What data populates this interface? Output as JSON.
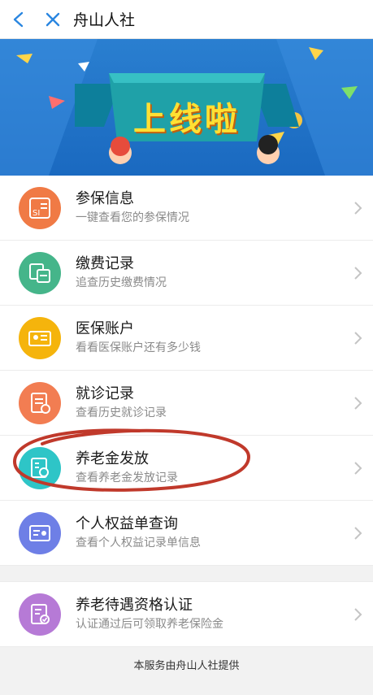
{
  "header": {
    "title": "舟山人社"
  },
  "banner": {
    "text": "上线啦"
  },
  "menu": [
    {
      "title": "参保信息",
      "subtitle": "一键查看您的参保情况",
      "icon": "insurance-info-icon",
      "color": "#f07a45"
    },
    {
      "title": "缴费记录",
      "subtitle": "追查历史缴费情况",
      "icon": "payment-record-icon",
      "color": "#45b58a"
    },
    {
      "title": "医保账户",
      "subtitle": "看看医保账户还有多少钱",
      "icon": "medical-account-icon",
      "color": "#f5b40c"
    },
    {
      "title": "就诊记录",
      "subtitle": "查看历史就诊记录",
      "icon": "visit-record-icon",
      "color": "#f27d52"
    },
    {
      "title": "养老金发放",
      "subtitle": "查看养老金发放记录",
      "icon": "pension-payment-icon",
      "color": "#2ec5c7"
    },
    {
      "title": "个人权益单查询",
      "subtitle": "查看个人权益记录单信息",
      "icon": "rights-query-icon",
      "color": "#6e7fe6"
    },
    {
      "title": "养老待遇资格认证",
      "subtitle": "认证通过后可领取养老保险金",
      "icon": "qualification-cert-icon",
      "color": "#b67ad6"
    }
  ],
  "footer": {
    "text": "本服务由舟山人社提供"
  },
  "colors": {
    "accent": "#2a86e0",
    "highlight_circle": "#c0392b"
  }
}
